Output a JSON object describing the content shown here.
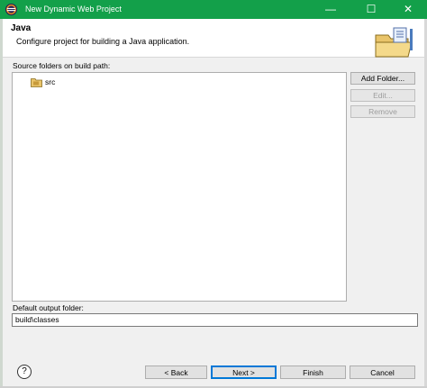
{
  "window": {
    "title": "New Dynamic Web Project",
    "controls": {
      "minimize": "—",
      "maximize": "☐",
      "close": "✕"
    }
  },
  "header": {
    "title": "Java",
    "description": "Configure project for building a Java application."
  },
  "source_folders": {
    "label": "Source folders on build path:",
    "items": [
      {
        "label": "src",
        "icon": "source-folder-icon"
      }
    ]
  },
  "side_buttons": {
    "add_folder": "Add Folder...",
    "edit": "Edit...",
    "remove": "Remove"
  },
  "output_folder": {
    "label": "Default output folder:",
    "value": "build\\classes"
  },
  "footer": {
    "help": "?",
    "back": "< Back",
    "next": "Next >",
    "finish": "Finish",
    "cancel": "Cancel"
  },
  "colors": {
    "titlebar": "#13a04a",
    "dialog_bg": "#f0f0f0",
    "default_button_border": "#0078d7"
  }
}
